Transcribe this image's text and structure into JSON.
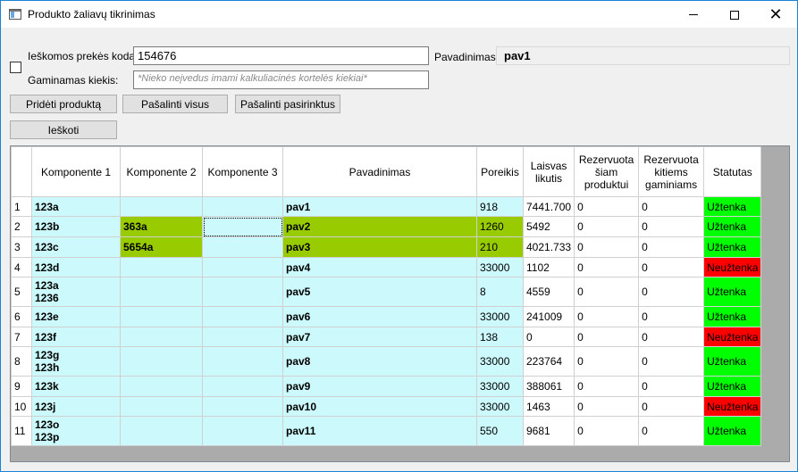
{
  "window": {
    "title": "Produkto žaliavų tikrinimas",
    "minimize": "—",
    "maximize": "☐",
    "close": "✕"
  },
  "form": {
    "search_code_label": "Ieškomos prekės kodas:",
    "search_code_value": "154676",
    "quantity_label": "Gaminamas kiekis:",
    "quantity_placeholder": "*Nieko neįvedus imami kalkuliacinės kortelės kiekiai*",
    "name_label": "Pavadinimas:",
    "name_value": "pav1"
  },
  "buttons": {
    "add_product": "Pridėti produktą",
    "remove_all": "Pašalinti visus",
    "remove_selected": "Pašalinti pasirinktus",
    "search": "Ieškoti"
  },
  "grid": {
    "headers": [
      "Komponente 1",
      "Komponente 2",
      "Komponente 3",
      "Pavadinimas",
      "Poreikis",
      "Laisvas likutis",
      "Rezervuota šiam produktui",
      "Rezervuota kitiems gaminiams",
      "Statutas"
    ],
    "rows": [
      {
        "n": "1",
        "k1": "123a",
        "k2": "",
        "k3": "",
        "name": "pav1",
        "poreikis": "918",
        "likutis": "7441.700",
        "rez1": "0",
        "rez2": "0",
        "status": "Užtenka",
        "ok": true
      },
      {
        "n": "2",
        "k1": "123b",
        "k2": "363a",
        "k3": "",
        "name": "pav2",
        "poreikis": "1260",
        "likutis": "5492",
        "rez1": "0",
        "rez2": "0",
        "status": "Užtenka",
        "ok": true
      },
      {
        "n": "3",
        "k1": "123c",
        "k2": "5654a",
        "k3": "",
        "name": "pav3",
        "poreikis": "210",
        "likutis": "4021.733",
        "rez1": "0",
        "rez2": "0",
        "status": "Užtenka",
        "ok": true
      },
      {
        "n": "4",
        "k1": "123d",
        "k2": "",
        "k3": "",
        "name": "pav4",
        "poreikis": "33000",
        "likutis": "1102",
        "rez1": "0",
        "rez2": "0",
        "status": "Neužtenka",
        "ok": false
      },
      {
        "n": "5",
        "k1": "123a\n1236",
        "k2": "",
        "k3": "",
        "name": "pav5",
        "poreikis": "8",
        "likutis": "4559",
        "rez1": "0",
        "rez2": "0",
        "status": "Užtenka",
        "ok": true
      },
      {
        "n": "6",
        "k1": "123e",
        "k2": "",
        "k3": "",
        "name": "pav6",
        "poreikis": "33000",
        "likutis": "241009",
        "rez1": "0",
        "rez2": "0",
        "status": "Užtenka",
        "ok": true
      },
      {
        "n": "7",
        "k1": "123f",
        "k2": "",
        "k3": "",
        "name": "pav7",
        "poreikis": "138",
        "likutis": "0",
        "rez1": "0",
        "rez2": "0",
        "status": "Neužtenka",
        "ok": false
      },
      {
        "n": "8",
        "k1": "123g\n123h",
        "k2": "",
        "k3": "",
        "name": "pav8",
        "poreikis": "33000",
        "likutis": "223764",
        "rez1": "0",
        "rez2": "0",
        "status": "Užtenka",
        "ok": true
      },
      {
        "n": "9",
        "k1": "123k",
        "k2": "",
        "k3": "",
        "name": "pav9",
        "poreikis": "33000",
        "likutis": "388061",
        "rez1": "0",
        "rez2": "0",
        "status": "Užtenka",
        "ok": true
      },
      {
        "n": "10",
        "k1": "123j",
        "k2": "",
        "k3": "",
        "name": "pav10",
        "poreikis": "33000",
        "likutis": "1463",
        "rez1": "0",
        "rez2": "0",
        "status": "Neužtenka",
        "ok": false
      },
      {
        "n": "11",
        "k1": "123o\n123p",
        "k2": "",
        "k3": "",
        "name": "pav11",
        "poreikis": "550",
        "likutis": "9681",
        "rez1": "0",
        "rez2": "0",
        "status": "Užtenka",
        "ok": true
      }
    ]
  },
  "colors": {
    "grid_cell": "#ccf9fb",
    "highlight": "#99cc00",
    "status_ok": "#00ff00",
    "status_bad": "#ff0000"
  }
}
